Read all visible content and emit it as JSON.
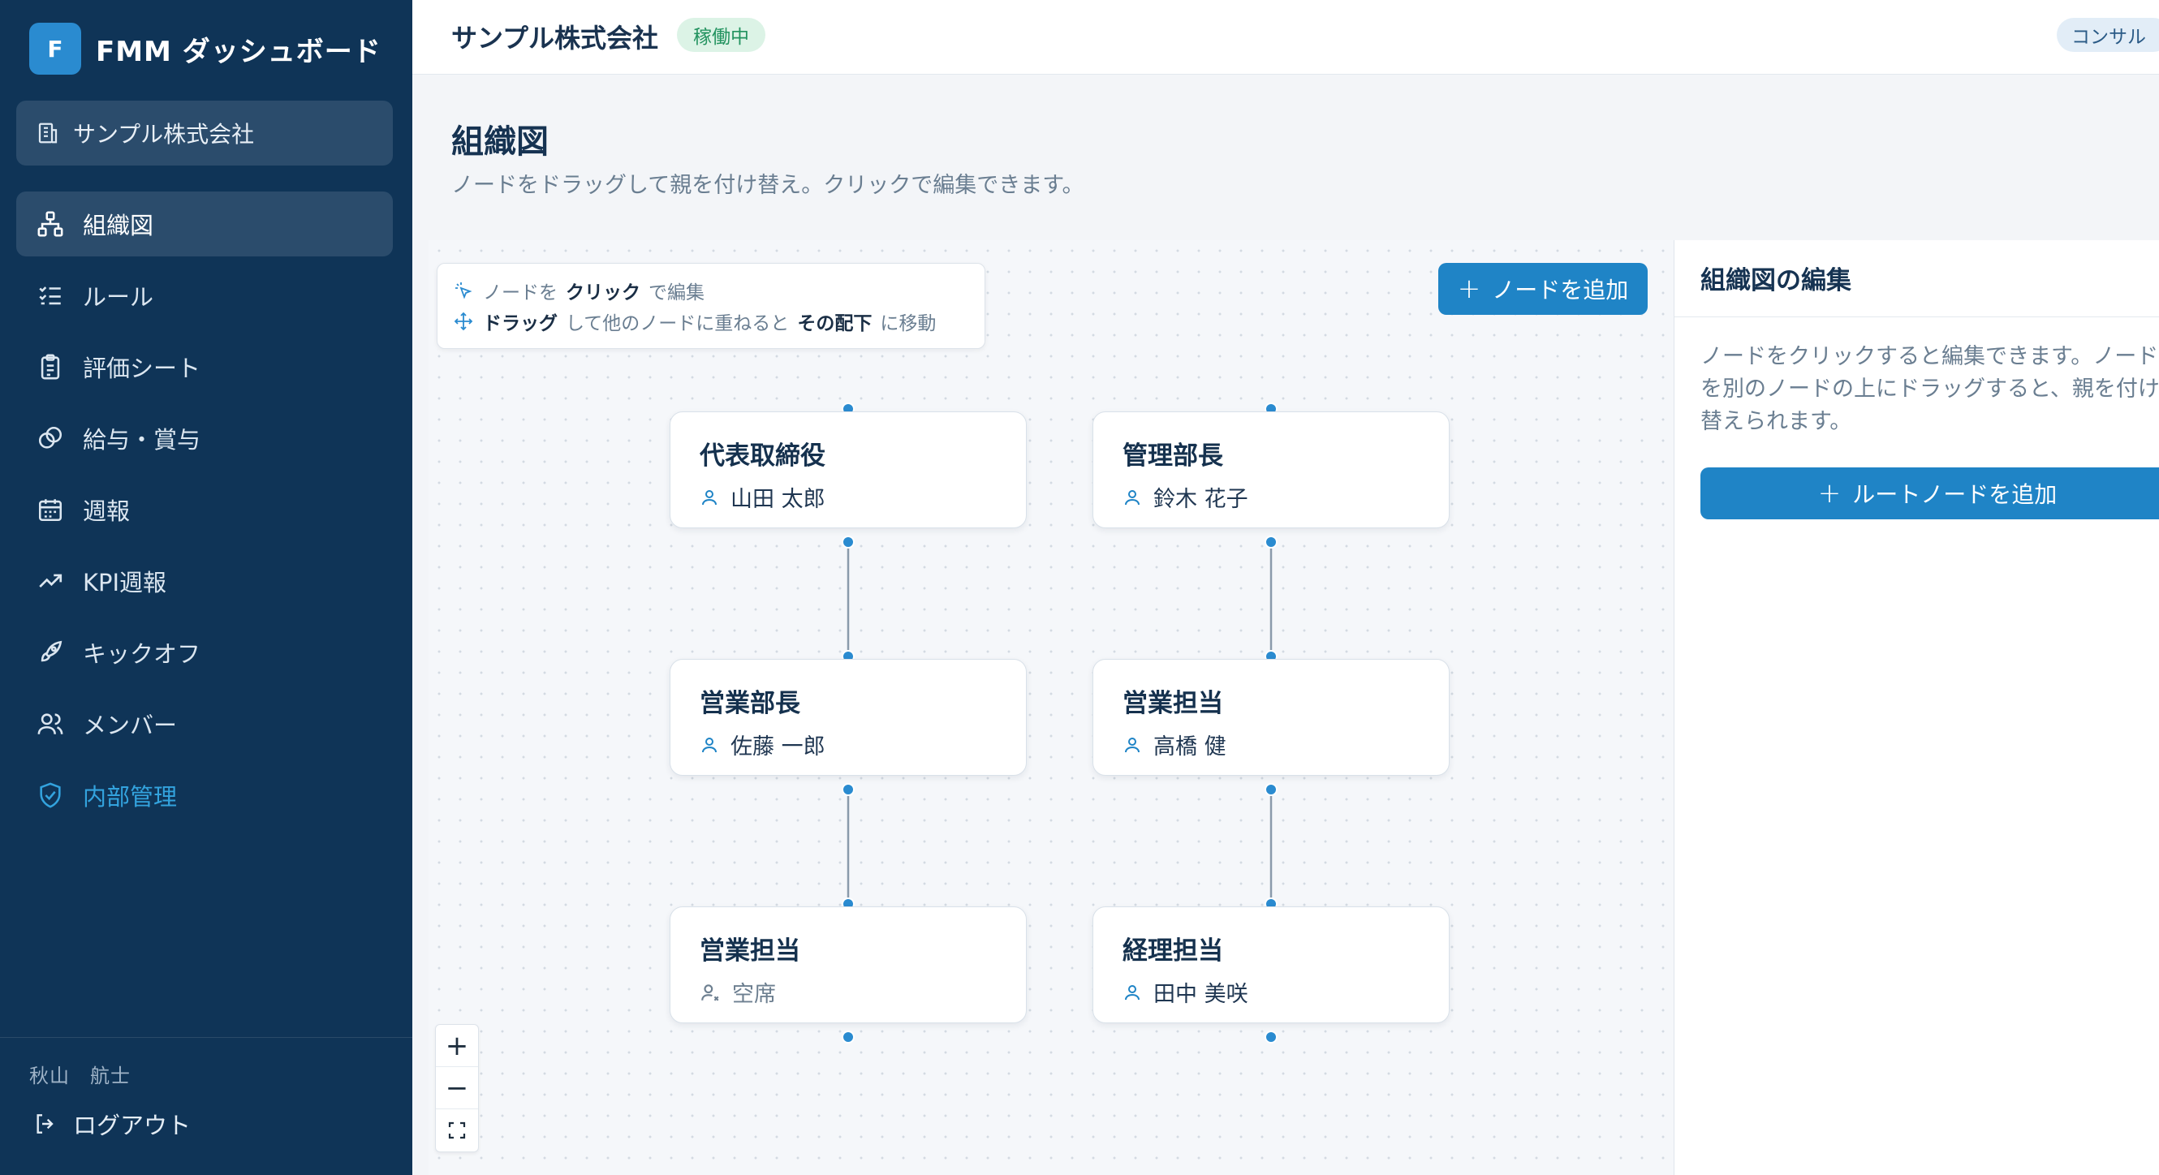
{
  "sidebar": {
    "brand_letter": "F",
    "brand_title": "FMM ダッシュボード",
    "company": "サンプル株式会社",
    "items": [
      {
        "label": "組織図",
        "icon": "org-chart-icon"
      },
      {
        "label": "ルール",
        "icon": "checklist-icon"
      },
      {
        "label": "評価シート",
        "icon": "clipboard-icon"
      },
      {
        "label": "給与・賞与",
        "icon": "coins-icon"
      },
      {
        "label": "週報",
        "icon": "calendar-icon"
      },
      {
        "label": "KPI週報",
        "icon": "trending-up-icon"
      },
      {
        "label": "キックオフ",
        "icon": "rocket-icon"
      },
      {
        "label": "メンバー",
        "icon": "users-icon"
      },
      {
        "label": "内部管理",
        "icon": "shield-check-icon"
      }
    ],
    "user_name": "秋山　航士",
    "logout": "ログアウト"
  },
  "topbar": {
    "company": "サンプル株式会社",
    "status": "稼働中",
    "role": "コンサル"
  },
  "page": {
    "title": "組織図",
    "subtitle": "ノードをドラッグして親を付け替え。クリックで編集できます。"
  },
  "hint": {
    "line1_a": "ノードを",
    "line1_b": "クリック",
    "line1_c": "で編集",
    "line2_a": "ドラッグ",
    "line2_b": "して他のノードに重ねると",
    "line2_c": "その配下",
    "line2_d": "に移動"
  },
  "add_node_label": "ノードを追加",
  "nodes": [
    {
      "title": "代表取締役",
      "person": "山田 太郎",
      "vacant": false
    },
    {
      "title": "営業部長",
      "person": "佐藤 一郎",
      "vacant": false
    },
    {
      "title": "営業担当",
      "person": "空席",
      "vacant": true
    },
    {
      "title": "管理部長",
      "person": "鈴木 花子",
      "vacant": false
    },
    {
      "title": "営業担当",
      "person": "高橋 健",
      "vacant": false
    },
    {
      "title": "経理担当",
      "person": "田中 美咲",
      "vacant": false
    }
  ],
  "zoom": {
    "in": "+",
    "out": "−",
    "fit": "⛶"
  },
  "panel": {
    "title": "組織図の編集",
    "desc": "ノードをクリックすると編集できます。ノードを別のノードの上にドラッグすると、親を付け替えられます。",
    "root_button": "ルートノードを追加"
  },
  "colors": {
    "sidebar_bg": "#0f3457",
    "accent": "#1f84c6",
    "status_green": "#239360",
    "admin_link": "#33a3de"
  }
}
